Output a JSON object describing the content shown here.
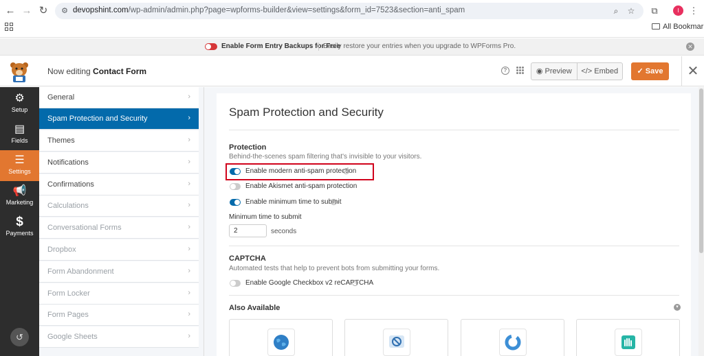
{
  "browser": {
    "url_host": "devopshint.com",
    "url_path": "/wp-admin/admin.php?page=wpforms-builder&view=settings&form_id=7523&section=anti_spam",
    "bookmarks_label": "All Bookmarks",
    "profile_initial": "I"
  },
  "notice": {
    "title": "Enable Form Entry Backups for Free",
    "text": "Easily restore your entries when you upgrade to WPForms Pro."
  },
  "header": {
    "editing_prefix": "Now editing",
    "form_name": "Contact Form",
    "preview_label": "Preview",
    "embed_label": "Embed",
    "save_label": "Save"
  },
  "leftnav": {
    "items": [
      {
        "label": "Setup",
        "icon": "gear-icon"
      },
      {
        "label": "Fields",
        "icon": "fields-icon"
      },
      {
        "label": "Settings",
        "icon": "sliders-icon",
        "active": true
      },
      {
        "label": "Marketing",
        "icon": "megaphone-icon"
      },
      {
        "label": "Payments",
        "icon": "dollar-icon"
      }
    ]
  },
  "settings_menu": {
    "items": [
      {
        "label": "General"
      },
      {
        "label": "Spam Protection and Security",
        "active": true
      },
      {
        "label": "Themes"
      },
      {
        "label": "Notifications"
      },
      {
        "label": "Confirmations"
      },
      {
        "label": "Calculations",
        "disabled": true
      },
      {
        "label": "Conversational Forms",
        "disabled": true
      },
      {
        "label": "Dropbox",
        "disabled": true
      },
      {
        "label": "Form Abandonment",
        "disabled": true
      },
      {
        "label": "Form Locker",
        "disabled": true
      },
      {
        "label": "Form Pages",
        "disabled": true
      },
      {
        "label": "Google Sheets",
        "disabled": true
      }
    ]
  },
  "panel": {
    "title": "Spam Protection and Security",
    "protection": {
      "title": "Protection",
      "desc": "Behind-the-scenes spam filtering that's invisible to your visitors.",
      "toggles": [
        {
          "label": "Enable modern anti-spam protection",
          "on": true,
          "help": true
        },
        {
          "label": "Enable Akismet anti-spam protection",
          "on": false,
          "help": false
        },
        {
          "label": "Enable minimum time to submit",
          "on": true,
          "help": true
        }
      ],
      "min_time_label": "Minimum time to submit",
      "min_time_value": "2",
      "min_time_unit": "seconds"
    },
    "captcha": {
      "title": "CAPTCHA",
      "desc": "Automated tests that help to prevent bots from submitting your forms.",
      "toggle_label": "Enable Google Checkbox v2 reCAPTCHA",
      "toggle_on": false
    },
    "also_available": {
      "title": "Also Available",
      "addons": [
        "globe-icon",
        "block-icon",
        "ring-icon",
        "hand-icon"
      ]
    }
  }
}
